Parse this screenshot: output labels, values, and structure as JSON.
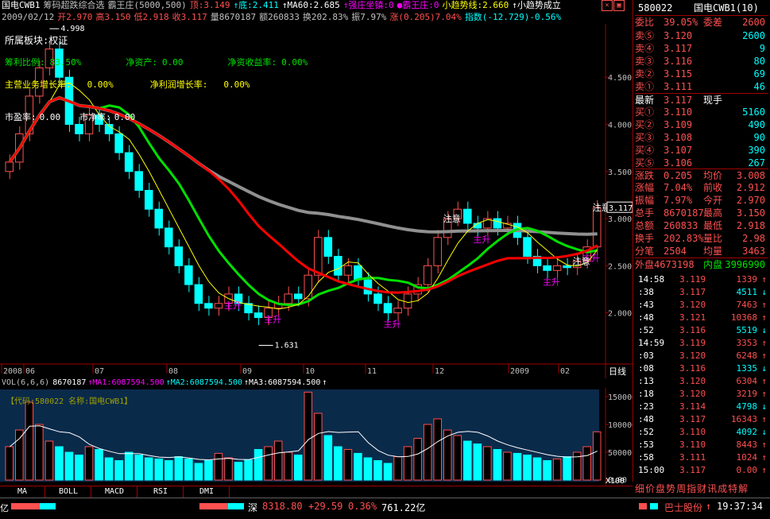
{
  "header": {
    "line1": [
      {
        "text": "国电CWB1",
        "color": "#ffffff"
      },
      {
        "text": "筹码超跌综合选",
        "color": "#c0c0c0"
      },
      {
        "text": "霸王庄(5000,500)",
        "color": "#c0c0c0"
      },
      {
        "text": "顶:3.149",
        "color": "#ff5050"
      },
      {
        "text": "↑底:2.411",
        "color": "#00ffff"
      },
      {
        "text": "↑MA60:2.685",
        "color": "#ffffff"
      },
      {
        "text": "↑强庄坐镇:0",
        "color": "#ff00ff"
      },
      {
        "text": "●霸王庄:0",
        "color": "#ff00ff"
      },
      {
        "text": "小趋势线:2.660",
        "color": "#ffff00"
      },
      {
        "text": "↑小趋势成立",
        "color": "#ffffff"
      }
    ],
    "line2": [
      {
        "text": "2009/02/12",
        "color": "#c0c0c0"
      },
      {
        "text": "开2.970",
        "color": "#ff5050"
      },
      {
        "text": "高3.150",
        "color": "#ff5050"
      },
      {
        "text": "低2.918",
        "color": "#ff5050"
      },
      {
        "text": "收3.117",
        "color": "#ff5050"
      },
      {
        "text": "量8670187",
        "color": "#c0c0c0"
      },
      {
        "text": "额260833",
        "color": "#c0c0c0"
      },
      {
        "text": "换202.83%",
        "color": "#c0c0c0"
      },
      {
        "text": "振7.97%",
        "color": "#c0c0c0"
      },
      {
        "text": "涨(0.205)7.04%",
        "color": "#ff5050"
      },
      {
        "text": "指数(-12.729)-0.56%",
        "color": "#00ffff"
      }
    ]
  },
  "overlay": {
    "sector_label": "所属板块:权证",
    "ratios": [
      {
        "label": "筹利比例:",
        "value": "83.50%",
        "color": "#00e000"
      },
      {
        "label": "净资产:",
        "value": "0.00",
        "color": "#00e000"
      },
      {
        "label": "净资收益率:",
        "value": "0.00%",
        "color": "#00e000"
      }
    ],
    "growth": [
      {
        "label": "主营业务增长率:",
        "value": "0.00%",
        "color": "#ffff00"
      },
      {
        "label": "净利润增长率:",
        "value": "0.00%",
        "color": "#ffff00"
      }
    ],
    "valuation": [
      {
        "label": "市盈率:",
        "value": "0.00"
      },
      {
        "label": "市净率:",
        "value": "0.00"
      }
    ],
    "high_marker": "4.998",
    "low_marker": "1.631",
    "last_price_tag": "3.117",
    "annotations": [
      "主升",
      "主升",
      "主升",
      "主升",
      "主升",
      "主升",
      "注意",
      "注意",
      "注意"
    ]
  },
  "chart_data": [
    {
      "type": "candlestick",
      "title": "",
      "y_ticks": [
        "4.500",
        "4.000",
        "3.500",
        "3.000",
        "2.500",
        "2.000"
      ],
      "ylim": [
        1.55,
        5.05
      ],
      "x_ticks": [
        "2008",
        "06",
        "07",
        "08",
        "09",
        "10",
        "11",
        "12",
        "2009",
        "02"
      ],
      "period_label": "日线",
      "series": [
        {
          "name": "close",
          "values": [
            3.6,
            3.9,
            4.3,
            4.6,
            4.8,
            4.5,
            4.0,
            3.9,
            4.1,
            4.0,
            3.9,
            3.7,
            3.5,
            3.3,
            3.1,
            2.9,
            2.7,
            2.5,
            2.3,
            2.1,
            2.05,
            2.1,
            2.2,
            2.1,
            2.0,
            1.95,
            2.05,
            2.1,
            2.2,
            2.15,
            2.4,
            2.8,
            2.6,
            2.4,
            2.5,
            2.35,
            2.2,
            2.1,
            2.0,
            2.05,
            2.2,
            2.3,
            2.5,
            2.8,
            3.0,
            3.1,
            2.95,
            2.9,
            3.0,
            2.9,
            2.95,
            2.8,
            2.6,
            2.5,
            2.45,
            2.5,
            2.48,
            2.55,
            2.7,
            3.117
          ]
        }
      ]
    },
    {
      "type": "bar",
      "title": "",
      "indicator": "VOL(6,6,6)",
      "values_text": [
        {
          "text": "8670187",
          "color": "#ffffff"
        },
        {
          "text": "↑MA1:6087594.500",
          "color": "#ff00ff"
        },
        {
          "text": "↑MA2:6087594.500",
          "color": "#00ffff"
        },
        {
          "text": "↑MA3:6087594.500",
          "color": "#ffffff"
        },
        {
          "text": "↑",
          "color": "#ffffff"
        }
      ],
      "code_label": "【代码:580022 名称:国电CWB1】",
      "y_ticks": [
        "150000",
        "100000",
        "50000",
        "0.00"
      ],
      "ylim": [
        0,
        160000
      ],
      "unit": "X100",
      "series": [
        {
          "name": "volume",
          "values": [
            60000,
            90000,
            140000,
            100000,
            70000,
            60000,
            50000,
            45000,
            60000,
            55000,
            40000,
            35000,
            50000,
            45000,
            40000,
            38000,
            35000,
            42000,
            38000,
            30000,
            35000,
            48000,
            40000,
            32000,
            36000,
            55000,
            60000,
            70000,
            50000,
            45000,
            158000,
            120000,
            80000,
            60000,
            55000,
            48000,
            40000,
            35000,
            30000,
            42000,
            60000,
            75000,
            100000,
            110000,
            90000,
            80000,
            70000,
            65000,
            60000,
            55000,
            50000,
            48000,
            45000,
            40000,
            35000,
            38000,
            42000,
            50000,
            60000,
            86702
          ]
        }
      ]
    }
  ],
  "quote": {
    "code": "580022",
    "name": "国电CWB1(10)",
    "ratio_label": "委比",
    "ratio_value": "39.05%",
    "diff_label": "委差",
    "diff_value": "2600",
    "asks": [
      {
        "label": "卖⑤",
        "price": "3.120",
        "vol": "2600"
      },
      {
        "label": "卖④",
        "price": "3.117",
        "vol": "9"
      },
      {
        "label": "卖③",
        "price": "3.116",
        "vol": "80"
      },
      {
        "label": "卖②",
        "price": "3.115",
        "vol": "69"
      },
      {
        "label": "卖①",
        "price": "3.111",
        "vol": "46"
      }
    ],
    "latest_label": "最新",
    "latest_price": "3.117",
    "latest_extra": "现手",
    "bids": [
      {
        "label": "买①",
        "price": "3.110",
        "vol": "5160"
      },
      {
        "label": "买②",
        "price": "3.109",
        "vol": "490"
      },
      {
        "label": "买③",
        "price": "3.108",
        "vol": "90"
      },
      {
        "label": "买④",
        "price": "3.107",
        "vol": "390"
      },
      {
        "label": "买⑤",
        "price": "3.106",
        "vol": "267"
      }
    ],
    "stats": [
      {
        "l1": "涨跌",
        "v1": "0.205",
        "l2": "均价",
        "v2": "3.008"
      },
      {
        "l1": "涨幅",
        "v1": "7.04%",
        "l2": "前收",
        "v2": "2.912"
      },
      {
        "l1": "振幅",
        "v1": "7.97%",
        "l2": "今开",
        "v2": "2.970"
      },
      {
        "l1": "总手",
        "v1": "8670187",
        "l2": "最高",
        "v2": "3.150"
      },
      {
        "l1": "总额",
        "v1": "260833",
        "l2": "最低",
        "v2": "2.918"
      },
      {
        "l1": "换手",
        "v1": "202.83%",
        "l2": "量比",
        "v2": "2.98"
      },
      {
        "l1": "分笔",
        "v1": "2504",
        "l2": "均量",
        "v2": "3463"
      }
    ],
    "outer_label": "外盘",
    "outer_value": "4673198",
    "inner_label": "内盘",
    "inner_value": "3996990",
    "ticks": [
      {
        "t": "14:58",
        "p": "3.119",
        "v": "1339",
        "a": "↑"
      },
      {
        "t": ":38",
        "p": "3.117",
        "v": "4511",
        "a": "↓"
      },
      {
        "t": ":43",
        "p": "3.120",
        "v": "7463",
        "a": "↑"
      },
      {
        "t": ":48",
        "p": "3.121",
        "v": "10368",
        "a": "↑"
      },
      {
        "t": ":52",
        "p": "3.116",
        "v": "5519",
        "a": "↓"
      },
      {
        "t": "14:59",
        "p": "3.119",
        "v": "3353",
        "a": "↑"
      },
      {
        "t": ":03",
        "p": "3.120",
        "v": "6248",
        "a": "↑"
      },
      {
        "t": ":08",
        "p": "3.116",
        "v": "1335",
        "a": "↓"
      },
      {
        "t": ":13",
        "p": "3.120",
        "v": "6304",
        "a": "↑"
      },
      {
        "t": ":18",
        "p": "3.120",
        "v": "3219",
        "a": "↑"
      },
      {
        "t": ":23",
        "p": "3.114",
        "v": "4798",
        "a": "↓"
      },
      {
        "t": ":48",
        "p": "3.117",
        "v": "16343",
        "a": "↑"
      },
      {
        "t": ":52",
        "p": "3.110",
        "v": "4092",
        "a": "↓"
      },
      {
        "t": ":53",
        "p": "3.110",
        "v": "8443",
        "a": "↑"
      },
      {
        "t": ":58",
        "p": "3.111",
        "v": "1024",
        "a": "↑"
      },
      {
        "t": "15:00",
        "p": "3.117",
        "v": "0.00",
        "a": "↑"
      }
    ],
    "footer_tabs": [
      "细",
      "价",
      "盘",
      "势",
      "周",
      "指",
      "财",
      "讯",
      "成",
      "特",
      "解"
    ]
  },
  "tabs": [
    "MA",
    "BOLL",
    "MACD",
    "RSI",
    "DMI"
  ],
  "status": {
    "left_label": "亿",
    "market": "深",
    "index_value": "8318.80",
    "change": "+29.59",
    "pct": "0.36%",
    "amount": "761.22亿",
    "stock_name": "巴士股份",
    "arrow": "↑",
    "time": "19:37:34"
  },
  "colors": {
    "up": "#ff5050",
    "down": "#00ffff",
    "border": "#a00000",
    "bg": "#000000"
  }
}
